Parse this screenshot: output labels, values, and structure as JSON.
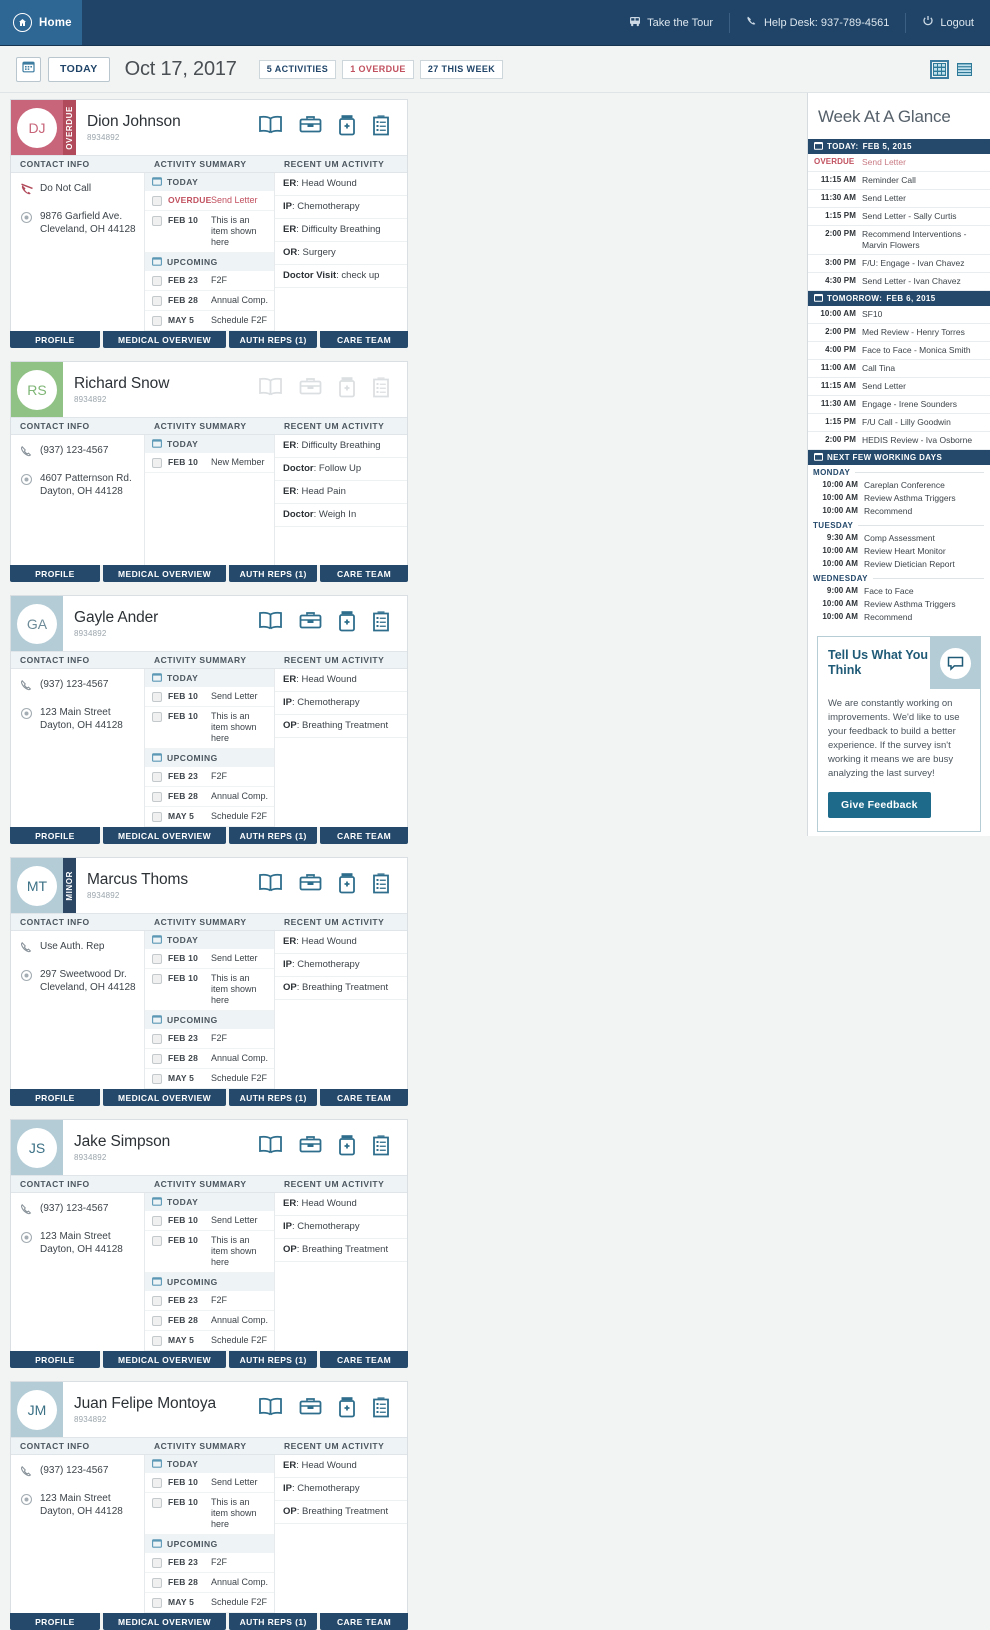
{
  "topnav": {
    "home_label": "Home",
    "items": [
      {
        "label": "Take the Tour",
        "icon": "bus-icon"
      },
      {
        "label": "Help Desk: 937-789-4561",
        "icon": "phone-icon"
      },
      {
        "label": "Logout",
        "icon": "power-icon"
      }
    ]
  },
  "toolbar": {
    "calendar_icon": "calendar-icon",
    "today_label": "TODAY",
    "date": "Oct 17, 2017",
    "pills": [
      {
        "label": "5 ACTIVITIES",
        "style": "normal"
      },
      {
        "label": "1 OVERDUE",
        "style": "overdue"
      },
      {
        "label": "27 THIS WEEK",
        "style": "normal"
      }
    ],
    "view_grid_icon": "grid-view-icon",
    "view_list_icon": "list-view-icon"
  },
  "columns": {
    "contact": "CONTACT INFO",
    "activity": "ACTIVITY SUMMARY",
    "um": "RECENT UM ACTIVITY"
  },
  "tabs": [
    "PROFILE",
    "MEDICAL OVERVIEW",
    "AUTH REPS (1)",
    "CARE TEAM"
  ],
  "card_icons": [
    "book-icon",
    "briefcase-icon",
    "pill-bottle-icon",
    "clipboard-icon"
  ],
  "colors": {
    "nav_bg": "#1f4468",
    "home_bg": "#2e6694",
    "accent_blue": "#24496b",
    "overdue_red": "#c1515f",
    "avatar_red": "#c8657a",
    "avatar_green": "#90c285",
    "avatar_teal": "#b3ccd6",
    "badge_dark": "#2b4763",
    "feedback_btn": "#1d6a8a"
  },
  "patients": [
    {
      "initials": "DJ",
      "name": "Dion Johnson",
      "id": "8934892",
      "avatar_bg": "#c8657a",
      "avatar_text": "#c8657a",
      "badge": "OVERDUE",
      "badge_bg": "#b14b5b",
      "icons_muted": false,
      "contact": [
        {
          "icon": "phone-do-not-call-icon",
          "text": "Do Not Call",
          "dnc": true
        },
        {
          "icon": "location-icon",
          "text": "9876 Garfield Ave. Cleveland, OH 44128"
        }
      ],
      "activity_groups": [
        {
          "label": "TODAY",
          "items": [
            {
              "date": "OVERDUE",
              "text": "Send Letter",
              "overdue": true
            },
            {
              "date": "FEB 10",
              "text": "This is an item shown here"
            }
          ]
        },
        {
          "label": "UPCOMING",
          "items": [
            {
              "date": "FEB 23",
              "text": "F2F"
            },
            {
              "date": "FEB 28",
              "text": "Annual Comp."
            },
            {
              "date": "MAY 5",
              "text": "Schedule F2F"
            }
          ]
        }
      ],
      "um": [
        {
          "code": "ER",
          "desc": "Head Wound"
        },
        {
          "code": "IP",
          "desc": "Chemotherapy"
        },
        {
          "code": "ER",
          "desc": "Difficulty Breathing"
        },
        {
          "code": "OR",
          "desc": "Surgery"
        },
        {
          "code": "Doctor Visit",
          "desc": "check up"
        }
      ]
    },
    {
      "initials": "RS",
      "name": "Richard Snow",
      "id": "8934892",
      "avatar_bg": "#90c285",
      "avatar_text": "#7fb575",
      "badge": null,
      "badge_bg": null,
      "icons_muted": true,
      "contact": [
        {
          "icon": "phone-icon",
          "text": "(937) 123-4567"
        },
        {
          "icon": "location-icon",
          "text": "4607 Patternson Rd. Dayton, OH 44128"
        }
      ],
      "activity_groups": [
        {
          "label": "TODAY",
          "items": [
            {
              "date": "FEB 10",
              "text": "New Member"
            }
          ]
        }
      ],
      "um": [
        {
          "code": "ER",
          "desc": "Difficulty Breathing"
        },
        {
          "code": "Doctor",
          "desc": "Follow Up"
        },
        {
          "code": "ER",
          "desc": "Head Pain"
        },
        {
          "code": "Doctor",
          "desc": "Weigh In"
        }
      ]
    },
    {
      "initials": "GA",
      "name": "Gayle Ander",
      "id": "8934892",
      "avatar_bg": "#b3ccd6",
      "avatar_text": "#6d8b98",
      "badge": null,
      "badge_bg": null,
      "icons_muted": false,
      "contact": [
        {
          "icon": "phone-icon",
          "text": "(937) 123-4567"
        },
        {
          "icon": "location-icon",
          "text": "123 Main Street Dayton, OH 44128"
        }
      ],
      "activity_groups": [
        {
          "label": "TODAY",
          "items": [
            {
              "date": "FEB 10",
              "text": "Send Letter"
            },
            {
              "date": "FEB 10",
              "text": "This is an item shown here"
            }
          ]
        },
        {
          "label": "UPCOMING",
          "items": [
            {
              "date": "FEB 23",
              "text": "F2F"
            },
            {
              "date": "FEB 28",
              "text": "Annual Comp."
            },
            {
              "date": "MAY 5",
              "text": "Schedule F2F"
            }
          ]
        }
      ],
      "um": [
        {
          "code": "ER",
          "desc": "Head Wound"
        },
        {
          "code": "IP",
          "desc": "Chemotherapy"
        },
        {
          "code": "OP",
          "desc": "Breathing Treatment"
        }
      ]
    },
    {
      "initials": "MT",
      "name": "Marcus Thoms",
      "id": "8934892",
      "avatar_bg": "#b3ccd6",
      "avatar_text": "#3c7186",
      "badge": "MINOR",
      "badge_bg": "#2b4763",
      "icons_muted": false,
      "contact": [
        {
          "icon": "phone-icon",
          "text": "Use Auth. Rep"
        },
        {
          "icon": "location-icon",
          "text": "297 Sweetwood Dr. Cleveland, OH 44128"
        }
      ],
      "activity_groups": [
        {
          "label": "TODAY",
          "items": [
            {
              "date": "FEB 10",
              "text": "Send Letter"
            },
            {
              "date": "FEB 10",
              "text": "This is an item shown here"
            }
          ]
        },
        {
          "label": "UPCOMING",
          "items": [
            {
              "date": "FEB 23",
              "text": "F2F"
            },
            {
              "date": "FEB 28",
              "text": "Annual Comp."
            },
            {
              "date": "MAY 5",
              "text": "Schedule F2F"
            }
          ]
        }
      ],
      "um": [
        {
          "code": "ER",
          "desc": "Head Wound"
        },
        {
          "code": "IP",
          "desc": "Chemotherapy"
        },
        {
          "code": "OP",
          "desc": "Breathing Treatment"
        }
      ]
    },
    {
      "initials": "JS",
      "name": "Jake Simpson",
      "id": "8934892",
      "avatar_bg": "#b3ccd6",
      "avatar_text": "#3c7186",
      "badge": null,
      "badge_bg": null,
      "icons_muted": false,
      "contact": [
        {
          "icon": "phone-icon",
          "text": "(937) 123-4567"
        },
        {
          "icon": "location-icon",
          "text": "123 Main Street Dayton, OH 44128"
        }
      ],
      "activity_groups": [
        {
          "label": "TODAY",
          "items": [
            {
              "date": "FEB 10",
              "text": "Send Letter"
            },
            {
              "date": "FEB 10",
              "text": "This is an item shown here"
            }
          ]
        },
        {
          "label": "UPCOMING",
          "items": [
            {
              "date": "FEB 23",
              "text": "F2F"
            },
            {
              "date": "FEB 28",
              "text": "Annual Comp."
            },
            {
              "date": "MAY 5",
              "text": "Schedule F2F"
            }
          ]
        }
      ],
      "um": [
        {
          "code": "ER",
          "desc": "Head Wound"
        },
        {
          "code": "IP",
          "desc": "Chemotherapy"
        },
        {
          "code": "OP",
          "desc": "Breathing Treatment"
        }
      ]
    },
    {
      "initials": "JM",
      "name": "Juan Felipe Montoya",
      "id": "8934892",
      "avatar_bg": "#b3ccd6",
      "avatar_text": "#3c7186",
      "badge": null,
      "badge_bg": null,
      "icons_muted": false,
      "contact": [
        {
          "icon": "phone-icon",
          "text": "(937) 123-4567"
        },
        {
          "icon": "location-icon",
          "text": "123 Main Street Dayton, OH 44128"
        }
      ],
      "activity_groups": [
        {
          "label": "TODAY",
          "items": [
            {
              "date": "FEB 10",
              "text": "Send Letter"
            },
            {
              "date": "FEB 10",
              "text": "This is an item shown here"
            }
          ]
        },
        {
          "label": "UPCOMING",
          "items": [
            {
              "date": "FEB 23",
              "text": "F2F"
            },
            {
              "date": "FEB 28",
              "text": "Annual Comp."
            },
            {
              "date": "MAY 5",
              "text": "Schedule F2F"
            }
          ]
        }
      ],
      "um": [
        {
          "code": "ER",
          "desc": "Head Wound"
        },
        {
          "code": "IP",
          "desc": "Chemotherapy"
        },
        {
          "code": "OP",
          "desc": "Breathing Treatment"
        }
      ]
    }
  ],
  "sidebar": {
    "title": "Week At A Glance",
    "sections": [
      {
        "head_prefix": "TODAY:",
        "head_date": "FEB 5, 2015",
        "rows": [
          {
            "time": "OVERDUE",
            "text": "Send Letter",
            "overdue": true
          },
          {
            "time": "11:15 AM",
            "text": "Reminder Call"
          },
          {
            "time": "11:30 AM",
            "text": "Send Letter"
          },
          {
            "time": "1:15 PM",
            "text": "Send Letter - Sally Curtis"
          },
          {
            "time": "2:00 PM",
            "text": "Recommend Interventions - Marvin Flowers"
          },
          {
            "time": "3:00 PM",
            "text": "F/U: Engage - Ivan Chavez"
          },
          {
            "time": "4:30 PM",
            "text": "Send Letter - Ivan Chavez"
          }
        ]
      },
      {
        "head_prefix": "TOMORROW:",
        "head_date": "FEB 6, 2015",
        "rows": [
          {
            "time": "10:00 AM",
            "text": "SF10"
          },
          {
            "time": "2:00 PM",
            "text": "Med Review - Henry Torres"
          },
          {
            "time": "4:00 PM",
            "text": "Face to Face - Monica Smith"
          },
          {
            "time": "11:00 AM",
            "text": "Call Tina"
          },
          {
            "time": "11:15 AM",
            "text": "Send Letter"
          },
          {
            "time": "11:30 AM",
            "text": "Engage - Irene Sounders"
          },
          {
            "time": "1:15 PM",
            "text": "F/U Call - Lilly Goodwin"
          },
          {
            "time": "2:00 PM",
            "text": "HEDIS Review - Iva Osborne"
          }
        ]
      }
    ],
    "working_days": {
      "head": "NEXT FEW WORKING DAYS",
      "days": [
        {
          "label": "MONDAY",
          "rows": [
            {
              "time": "10:00 AM",
              "text": "Careplan Conference"
            },
            {
              "time": "10:00 AM",
              "text": "Review Asthma Triggers"
            },
            {
              "time": "10:00 AM",
              "text": "Recommend"
            }
          ]
        },
        {
          "label": "TUESDAY",
          "rows": [
            {
              "time": "9:30 AM",
              "text": "Comp Assessment"
            },
            {
              "time": "10:00 AM",
              "text": "Review Heart Monitor"
            },
            {
              "time": "10:00 AM",
              "text": "Review Dietician Report"
            }
          ]
        },
        {
          "label": "WEDNESDAY",
          "rows": [
            {
              "time": "9:00 AM",
              "text": "Face to Face"
            },
            {
              "time": "10:00 AM",
              "text": "Review Asthma Triggers"
            },
            {
              "time": "10:00 AM",
              "text": "Recommend"
            }
          ]
        }
      ]
    },
    "feedback": {
      "title": "Tell Us What You Think",
      "icon": "chat-bubble-icon",
      "body": "We are constantly working on improvements. We'd like to use your feedback to build a better experience. If the survey isn't working it means we are busy analyzing the last survey!",
      "button": "Give Feedback"
    }
  }
}
